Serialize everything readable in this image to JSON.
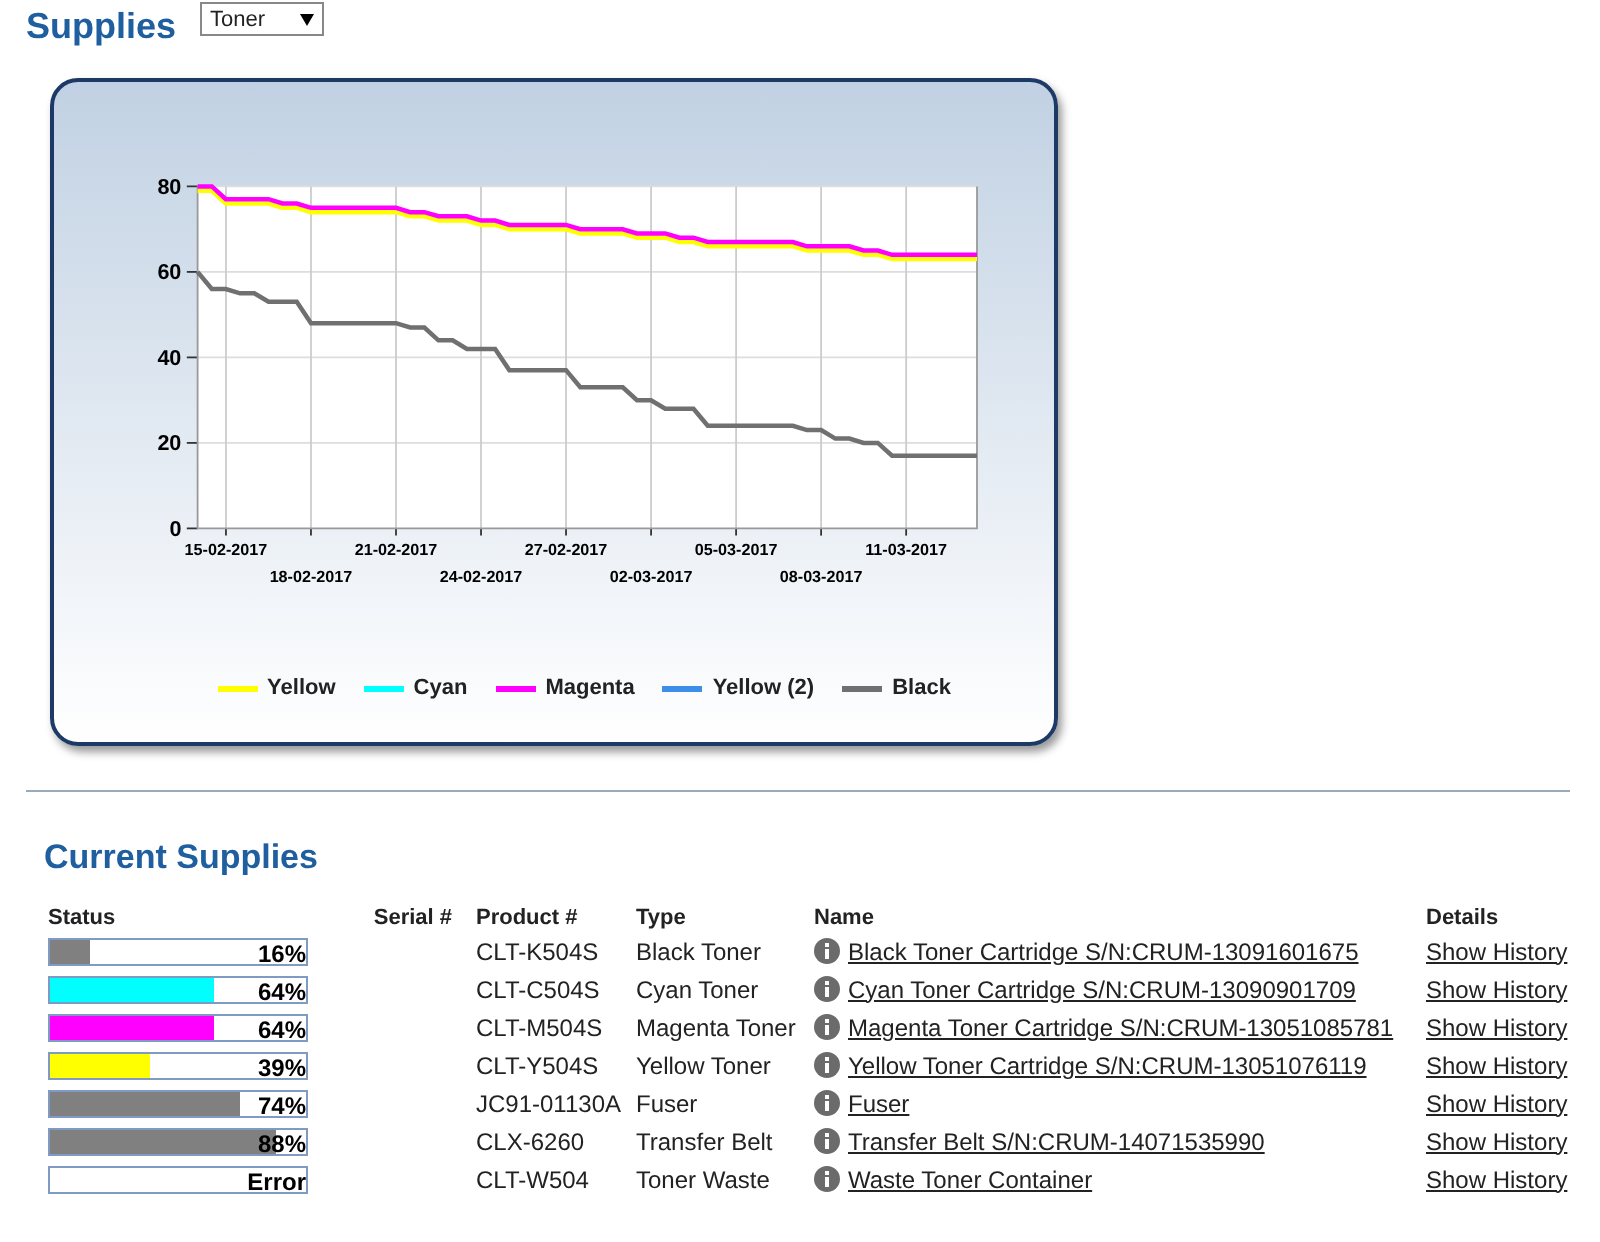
{
  "header": {
    "title": "Supplies",
    "select": {
      "value": "Toner"
    }
  },
  "chart_data": {
    "type": "line",
    "grid": true,
    "legend": "bottom",
    "ylim": [
      0,
      80
    ],
    "yticks": [
      0,
      20,
      40,
      60,
      80
    ],
    "categories": [
      null,
      null,
      "15-02-2017",
      null,
      null,
      null,
      null,
      null,
      "18-02-2017",
      null,
      null,
      null,
      null,
      null,
      "21-02-2017",
      null,
      null,
      null,
      null,
      null,
      "24-02-2017",
      null,
      null,
      null,
      null,
      null,
      "27-02-2017",
      null,
      null,
      null,
      null,
      null,
      "02-03-2017",
      null,
      null,
      null,
      null,
      null,
      "05-03-2017",
      null,
      null,
      null,
      null,
      null,
      "08-03-2017",
      null,
      null,
      null,
      null,
      null,
      "11-03-2017",
      null,
      null,
      null,
      null,
      null
    ],
    "series": [
      {
        "name": "Yellow",
        "color": "#ffff00",
        "values": [
          79,
          79,
          76,
          76,
          76,
          76,
          75,
          75,
          74,
          74,
          74,
          74,
          74,
          74,
          74,
          73,
          73,
          72,
          72,
          72,
          71,
          71,
          70,
          70,
          70,
          70,
          70,
          69,
          69,
          69,
          69,
          68,
          68,
          68,
          67,
          67,
          66,
          66,
          66,
          66,
          66,
          66,
          66,
          65,
          65,
          65,
          65,
          64,
          64,
          63,
          63,
          63,
          63,
          63,
          63,
          63
        ]
      },
      {
        "name": "Cyan",
        "color": "#00ffff",
        "values": [
          null,
          null,
          null,
          null,
          null,
          null,
          null,
          null,
          null,
          null,
          null,
          null,
          null,
          null,
          null,
          null,
          null,
          null,
          null,
          null,
          null,
          null,
          null,
          null,
          null,
          null,
          null,
          null,
          null,
          null,
          null,
          null,
          null,
          null,
          null,
          null,
          null,
          null,
          null,
          null,
          null,
          null,
          null,
          null,
          null,
          null,
          null,
          null,
          null,
          null,
          null,
          null,
          null,
          null,
          null,
          null
        ]
      },
      {
        "name": "Magenta",
        "color": "#ff00ff",
        "values": [
          80,
          80,
          77,
          77,
          77,
          77,
          76,
          76,
          75,
          75,
          75,
          75,
          75,
          75,
          75,
          74,
          74,
          73,
          73,
          73,
          72,
          72,
          71,
          71,
          71,
          71,
          71,
          70,
          70,
          70,
          70,
          69,
          69,
          69,
          68,
          68,
          67,
          67,
          67,
          67,
          67,
          67,
          67,
          66,
          66,
          66,
          66,
          65,
          65,
          64,
          64,
          64,
          64,
          64,
          64,
          64
        ]
      },
      {
        "name": "Yellow (2)",
        "color": "#3c8ee8",
        "values": [
          null,
          null,
          null,
          null,
          null,
          null,
          null,
          null,
          null,
          null,
          null,
          null,
          null,
          null,
          null,
          null,
          null,
          null,
          null,
          null,
          null,
          null,
          null,
          null,
          null,
          null,
          null,
          null,
          null,
          null,
          null,
          null,
          null,
          null,
          null,
          null,
          null,
          null,
          null,
          null,
          null,
          null,
          null,
          null,
          null,
          null,
          null,
          null,
          null,
          null,
          null,
          null,
          null,
          null,
          null,
          null
        ]
      },
      {
        "name": "Black",
        "color": "#707070",
        "values": [
          60,
          56,
          56,
          55,
          55,
          53,
          53,
          53,
          48,
          48,
          48,
          48,
          48,
          48,
          48,
          47,
          47,
          44,
          44,
          42,
          42,
          42,
          37,
          37,
          37,
          37,
          37,
          33,
          33,
          33,
          33,
          30,
          30,
          28,
          28,
          28,
          24,
          24,
          24,
          24,
          24,
          24,
          24,
          23,
          23,
          21,
          21,
          20,
          20,
          17,
          17,
          17,
          17,
          17,
          17,
          17
        ]
      }
    ]
  },
  "current": {
    "title": "Current Supplies",
    "columns": [
      "Status",
      "Serial #",
      "Product #",
      "Type",
      "Name",
      "Details"
    ],
    "rows": [
      {
        "status": {
          "level": 0.16,
          "reading": "16%",
          "color": "#808080"
        },
        "product": "CLT-K504S",
        "type": "Black Toner",
        "name": "Black Toner Cartridge S/N:CRUM-13091601675",
        "details": "Show History"
      },
      {
        "status": {
          "level": 0.64,
          "reading": "64%",
          "color": "#00ffff"
        },
        "product": "CLT-C504S",
        "type": "Cyan Toner",
        "name": "Cyan Toner Cartridge S/N:CRUM-13090901709",
        "details": "Show History"
      },
      {
        "status": {
          "level": 0.64,
          "reading": "64%",
          "color": "#ff00ff"
        },
        "product": "CLT-M504S",
        "type": "Magenta Toner",
        "name": "Magenta Toner Cartridge S/N:CRUM-13051085781",
        "details": "Show History"
      },
      {
        "status": {
          "level": 0.39,
          "reading": "39%",
          "color": "#ffff00"
        },
        "product": "CLT-Y504S",
        "type": "Yellow Toner",
        "name": "Yellow Toner Cartridge S/N:CRUM-13051076119",
        "details": "Show History"
      },
      {
        "status": {
          "level": 0.74,
          "reading": "74%",
          "color": "#808080"
        },
        "product": "JC91-01130A",
        "type": "Fuser",
        "name": "Fuser",
        "details": "Show History"
      },
      {
        "status": {
          "level": 0.88,
          "reading": "88%",
          "color": "#808080"
        },
        "product": "CLX-6260",
        "type": "Transfer Belt",
        "name": "Transfer Belt S/N:CRUM-14071535990",
        "details": "Show History"
      },
      {
        "status": {
          "reading": "Error"
        },
        "product": "CLT-W504",
        "type": "Toner Waste",
        "name": "Waste Toner Container",
        "details": "Show History"
      }
    ]
  }
}
